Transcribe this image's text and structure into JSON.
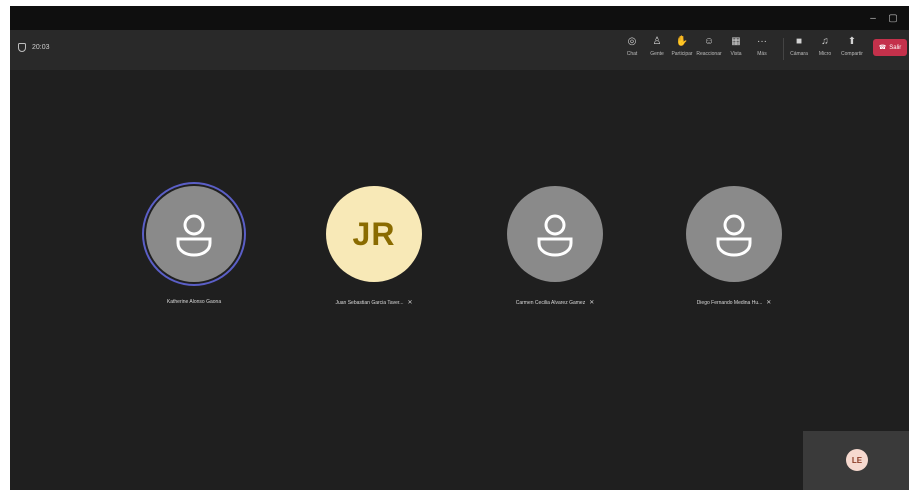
{
  "meeting": {
    "timer": "20:03"
  },
  "toolbar": {
    "items": [
      {
        "id": "chat",
        "label": "Chat",
        "icon": "chat-icon"
      },
      {
        "id": "people",
        "label": "Gente",
        "icon": "people-icon"
      },
      {
        "id": "raise",
        "label": "Participar",
        "icon": "raise-hand-icon"
      },
      {
        "id": "react",
        "label": "Reaccionar",
        "icon": "reaction-icon"
      },
      {
        "id": "view",
        "label": "Vista",
        "icon": "view-icon"
      },
      {
        "id": "more",
        "label": "Más",
        "icon": "more-icon"
      },
      {
        "id": "camera",
        "label": "Cámara",
        "icon": "camera-icon"
      },
      {
        "id": "mic",
        "label": "Micro",
        "icon": "mic-icon"
      },
      {
        "id": "share",
        "label": "Compartir",
        "icon": "share-icon"
      }
    ],
    "leave_label": "Salir",
    "leave_color": "#c4314b"
  },
  "participants": [
    {
      "name": "Katherine Alonso Gaona",
      "avatar": "person-icon",
      "speaking": true,
      "muted": false
    },
    {
      "name": "Juan Sebastian Garcia Taver...",
      "initials": "JR",
      "avatar_color": "#f8e9b7",
      "muted": true
    },
    {
      "name": "Carmen Cecilia Alvarez Gamez",
      "avatar": "person-icon",
      "muted": true
    },
    {
      "name": "Diego Fernando Medina Hu...",
      "avatar": "person-icon",
      "muted": true
    }
  ],
  "self_view": {
    "initials": "LE"
  },
  "colors": {
    "speaking_ring": "#5b5fc7",
    "stage_bg": "#1f1f1f",
    "toolbar_bg": "#292929"
  }
}
